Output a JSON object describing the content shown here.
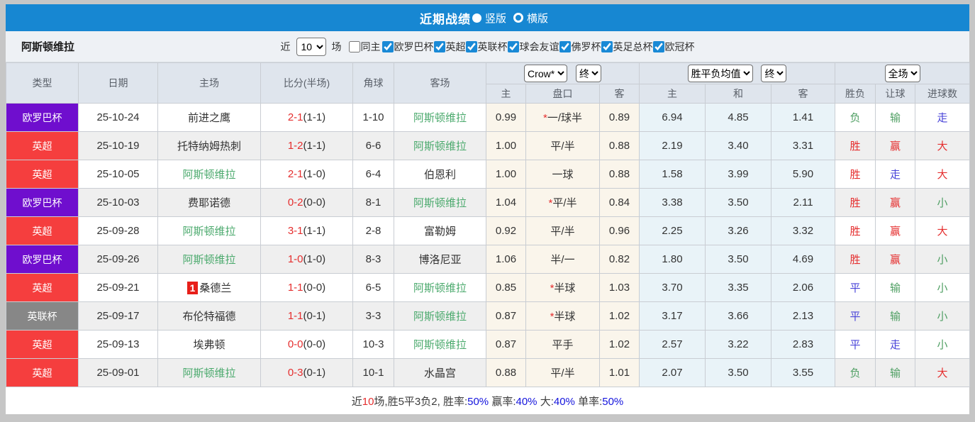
{
  "title_bar": {
    "title": "近期战绩",
    "radio_options": [
      {
        "label": "竖版",
        "selected": true
      },
      {
        "label": "横版",
        "selected": false
      }
    ]
  },
  "filter_bar": {
    "team_name": "阿斯顿维拉",
    "recent_label": "近",
    "recent_value": "10",
    "recent_suffix": "场",
    "checkboxes": [
      {
        "label": "同主",
        "checked": false
      },
      {
        "label": "欧罗巴杯",
        "checked": true
      },
      {
        "label": "英超",
        "checked": true
      },
      {
        "label": "英联杯",
        "checked": true
      },
      {
        "label": "球会友谊",
        "checked": true
      },
      {
        "label": "佛罗杯",
        "checked": true
      },
      {
        "label": "英足总杯",
        "checked": true
      },
      {
        "label": "欧冠杯",
        "checked": true
      }
    ]
  },
  "table": {
    "columns": [
      "类型",
      "日期",
      "主场",
      "比分(半场)",
      "角球",
      "客场"
    ],
    "sub_columns": [
      "主",
      "盘口",
      "客",
      "主",
      "和",
      "客",
      "胜负",
      "让球",
      "进球数"
    ],
    "selects": {
      "bookmaker": "Crow*",
      "bookmaker_time": "终",
      "avg_label": "胜平负均值",
      "avg_time": "终",
      "scope": "全场"
    },
    "rows": [
      {
        "league": "欧罗巴杯",
        "league_color": "#6f0ece",
        "date": "25-10-24",
        "home": "前进之鹰",
        "home_is_team": false,
        "home_badge": "",
        "score": "2-1",
        "half": "(1-1)",
        "corner": "1-10",
        "away": "阿斯顿维拉",
        "away_is_team": true,
        "odds_home": "0.99",
        "handicap_star": true,
        "handicap": "一/球半",
        "odds_away": "0.89",
        "avg_home": "6.94",
        "avg_draw": "4.85",
        "avg_away": "1.41",
        "result": "负",
        "result_color": "green",
        "handicap_result": "输",
        "handicap_result_color": "green",
        "goals": "走",
        "goals_color": "blue"
      },
      {
        "league": "英超",
        "league_color": "#f53e3e",
        "date": "25-10-19",
        "home": "托特纳姆热刺",
        "home_is_team": false,
        "home_badge": "",
        "score": "1-2",
        "half": "(1-1)",
        "corner": "6-6",
        "away": "阿斯顿维拉",
        "away_is_team": true,
        "odds_home": "1.00",
        "handicap_star": false,
        "handicap": "平/半",
        "odds_away": "0.88",
        "avg_home": "2.19",
        "avg_draw": "3.40",
        "avg_away": "3.31",
        "result": "胜",
        "result_color": "red",
        "handicap_result": "赢",
        "handicap_result_color": "red",
        "goals": "大",
        "goals_color": "red"
      },
      {
        "league": "英超",
        "league_color": "#f53e3e",
        "date": "25-10-05",
        "home": "阿斯顿维拉",
        "home_is_team": true,
        "home_badge": "",
        "score": "2-1",
        "half": "(1-0)",
        "corner": "6-4",
        "away": "伯恩利",
        "away_is_team": false,
        "odds_home": "1.00",
        "handicap_star": false,
        "handicap": "一球",
        "odds_away": "0.88",
        "avg_home": "1.58",
        "avg_draw": "3.99",
        "avg_away": "5.90",
        "result": "胜",
        "result_color": "red",
        "handicap_result": "走",
        "handicap_result_color": "blue",
        "goals": "大",
        "goals_color": "red"
      },
      {
        "league": "欧罗巴杯",
        "league_color": "#6f0ece",
        "date": "25-10-03",
        "home": "费耶诺德",
        "home_is_team": false,
        "home_badge": "",
        "score": "0-2",
        "half": "(0-0)",
        "corner": "8-1",
        "away": "阿斯顿维拉",
        "away_is_team": true,
        "odds_home": "1.04",
        "handicap_star": true,
        "handicap": "平/半",
        "odds_away": "0.84",
        "avg_home": "3.38",
        "avg_draw": "3.50",
        "avg_away": "2.11",
        "result": "胜",
        "result_color": "red",
        "handicap_result": "赢",
        "handicap_result_color": "red",
        "goals": "小",
        "goals_color": "green"
      },
      {
        "league": "英超",
        "league_color": "#f53e3e",
        "date": "25-09-28",
        "home": "阿斯顿维拉",
        "home_is_team": true,
        "home_badge": "",
        "score": "3-1",
        "half": "(1-1)",
        "corner": "2-8",
        "away": "富勒姆",
        "away_is_team": false,
        "odds_home": "0.92",
        "handicap_star": false,
        "handicap": "平/半",
        "odds_away": "0.96",
        "avg_home": "2.25",
        "avg_draw": "3.26",
        "avg_away": "3.32",
        "result": "胜",
        "result_color": "red",
        "handicap_result": "赢",
        "handicap_result_color": "red",
        "goals": "大",
        "goals_color": "red"
      },
      {
        "league": "欧罗巴杯",
        "league_color": "#6f0ece",
        "date": "25-09-26",
        "home": "阿斯顿维拉",
        "home_is_team": true,
        "home_badge": "",
        "score": "1-0",
        "half": "(1-0)",
        "corner": "8-3",
        "away": "博洛尼亚",
        "away_is_team": false,
        "odds_home": "1.06",
        "handicap_star": false,
        "handicap": "半/一",
        "odds_away": "0.82",
        "avg_home": "1.80",
        "avg_draw": "3.50",
        "avg_away": "4.69",
        "result": "胜",
        "result_color": "red",
        "handicap_result": "赢",
        "handicap_result_color": "red",
        "goals": "小",
        "goals_color": "green"
      },
      {
        "league": "英超",
        "league_color": "#f53e3e",
        "date": "25-09-21",
        "home": "桑德兰",
        "home_is_team": false,
        "home_badge": "1",
        "score": "1-1",
        "half": "(0-0)",
        "corner": "6-5",
        "away": "阿斯顿维拉",
        "away_is_team": true,
        "odds_home": "0.85",
        "handicap_star": true,
        "handicap": "半球",
        "odds_away": "1.03",
        "avg_home": "3.70",
        "avg_draw": "3.35",
        "avg_away": "2.06",
        "result": "平",
        "result_color": "blue",
        "handicap_result": "输",
        "handicap_result_color": "green",
        "goals": "小",
        "goals_color": "green"
      },
      {
        "league": "英联杯",
        "league_color": "#878787",
        "date": "25-09-17",
        "home": "布伦特福德",
        "home_is_team": false,
        "home_badge": "",
        "score": "1-1",
        "half": "(0-1)",
        "corner": "3-3",
        "away": "阿斯顿维拉",
        "away_is_team": true,
        "odds_home": "0.87",
        "handicap_star": true,
        "handicap": "半球",
        "odds_away": "1.02",
        "avg_home": "3.17",
        "avg_draw": "3.66",
        "avg_away": "2.13",
        "result": "平",
        "result_color": "blue",
        "handicap_result": "输",
        "handicap_result_color": "green",
        "goals": "小",
        "goals_color": "green"
      },
      {
        "league": "英超",
        "league_color": "#f53e3e",
        "date": "25-09-13",
        "home": "埃弗顿",
        "home_is_team": false,
        "home_badge": "",
        "score": "0-0",
        "half": "(0-0)",
        "corner": "10-3",
        "away": "阿斯顿维拉",
        "away_is_team": true,
        "odds_home": "0.87",
        "handicap_star": false,
        "handicap": "平手",
        "odds_away": "1.02",
        "avg_home": "2.57",
        "avg_draw": "3.22",
        "avg_away": "2.83",
        "result": "平",
        "result_color": "blue",
        "handicap_result": "走",
        "handicap_result_color": "blue",
        "goals": "小",
        "goals_color": "green"
      },
      {
        "league": "英超",
        "league_color": "#f53e3e",
        "date": "25-09-01",
        "home": "阿斯顿维拉",
        "home_is_team": true,
        "home_badge": "",
        "score": "0-3",
        "half": "(0-1)",
        "corner": "10-1",
        "away": "水晶宫",
        "away_is_team": false,
        "odds_home": "0.88",
        "handicap_star": false,
        "handicap": "平/半",
        "odds_away": "1.01",
        "avg_home": "2.07",
        "avg_draw": "3.50",
        "avg_away": "3.55",
        "result": "负",
        "result_color": "green",
        "handicap_result": "输",
        "handicap_result_color": "green",
        "goals": "大",
        "goals_color": "red"
      }
    ]
  },
  "footer": {
    "summary_parts": [
      {
        "text": "近",
        "color": "black"
      },
      {
        "text": "10",
        "color": "red"
      },
      {
        "text": "场,胜5平3负2, ",
        "color": "black"
      },
      {
        "text": "胜率:",
        "color": "black"
      },
      {
        "text": "50%",
        "color": "blue"
      },
      {
        "text": " 赢率:",
        "color": "black"
      },
      {
        "text": "40%",
        "color": "blue"
      },
      {
        "text": " 大:",
        "color": "black"
      },
      {
        "text": "40%",
        "color": "blue"
      },
      {
        "text": " 单率:",
        "color": "black"
      },
      {
        "text": "50%",
        "color": "blue"
      }
    ]
  },
  "colors": {
    "accent_blue": "#1787d2",
    "team_green": "#4aa96c",
    "score_red": "#e52e2e",
    "result_red": "#e52e2e",
    "result_green": "#4f9f63",
    "result_blue": "#4843d8",
    "league_europa": "#6f0ece",
    "league_premier": "#f53e3e",
    "league_efl_cup": "#878787",
    "odds_bg": "#faf5eb",
    "avg_bg": "#e9f3f8"
  }
}
